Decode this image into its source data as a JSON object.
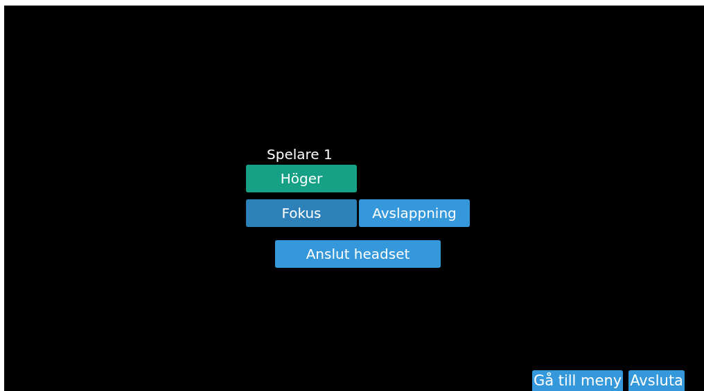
{
  "player": {
    "label": "Spelare 1"
  },
  "side_button": {
    "label": "Höger",
    "kind": "side"
  },
  "modes": [
    {
      "label": "Fokus",
      "selected": true
    },
    {
      "label": "Avslappning",
      "selected": false
    }
  ],
  "connect_button": {
    "label": "Anslut headset"
  },
  "footer_buttons": [
    {
      "label": "Gå till meny"
    },
    {
      "label": "Avsluta"
    }
  ]
}
